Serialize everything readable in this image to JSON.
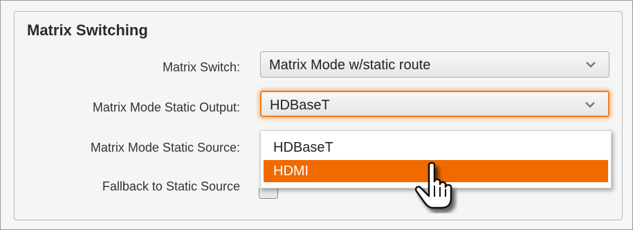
{
  "panel": {
    "title": "Matrix Switching"
  },
  "rows": [
    {
      "label": "Matrix Switch:",
      "value": "Matrix Mode w/static route"
    },
    {
      "label": "Matrix Mode Static Output:",
      "value": "HDBaseT"
    },
    {
      "label": "Matrix Mode Static Source:"
    },
    {
      "label": "Fallback to Static Source"
    }
  ],
  "dropdown": {
    "options": [
      "HDBaseT",
      "HDMI"
    ],
    "selected": "HDMI"
  },
  "icons": {
    "select_arrow": "chevron-down-icon",
    "pointer": "hand-pointer-icon"
  },
  "colors": {
    "accent": "#f06a00",
    "focus_ring": "#f07d1a"
  }
}
